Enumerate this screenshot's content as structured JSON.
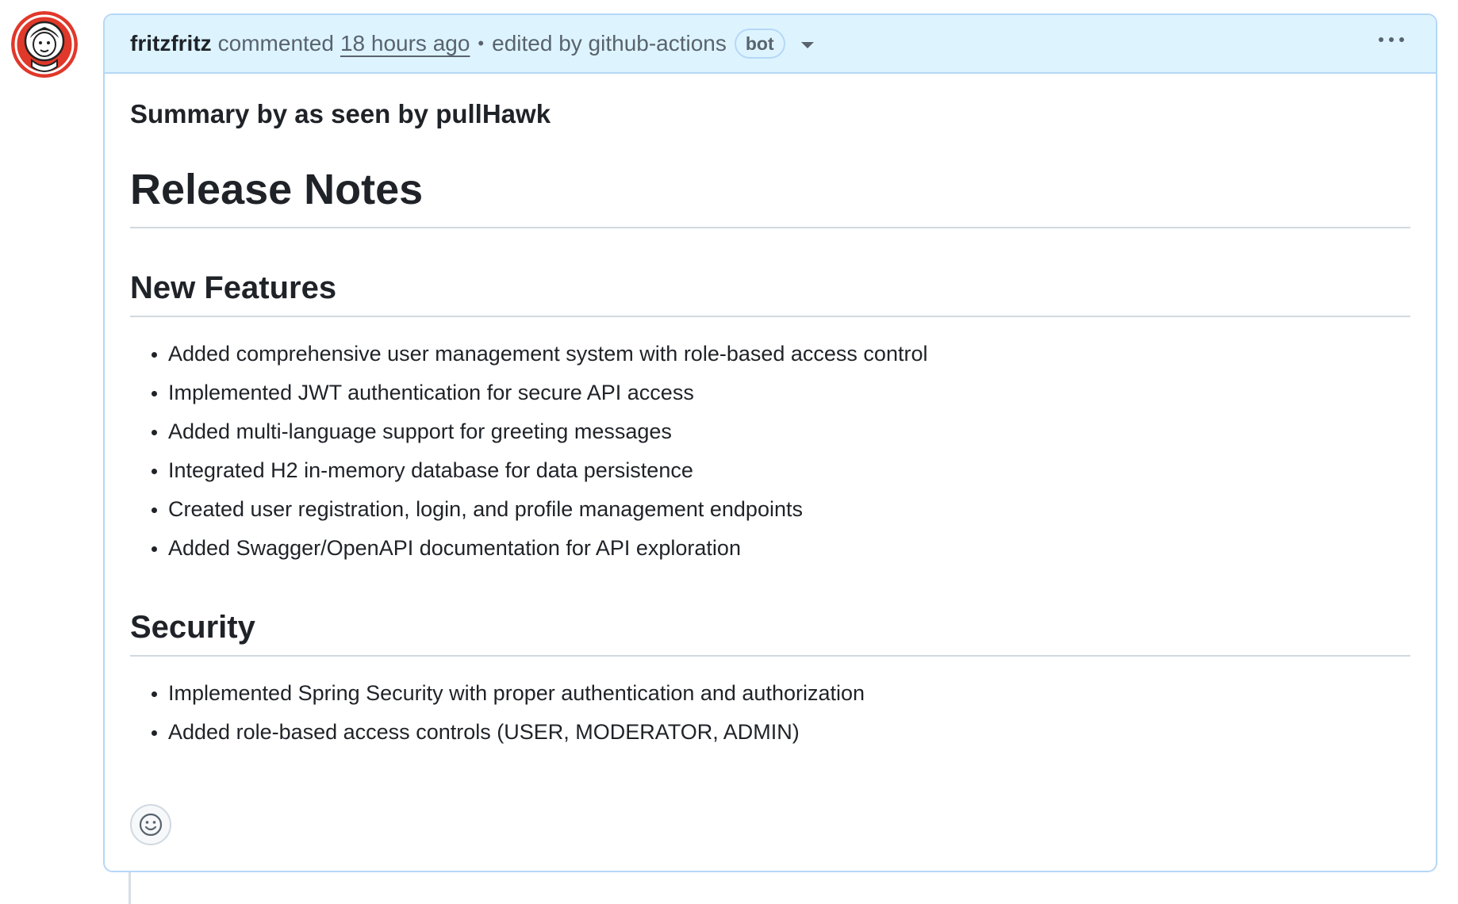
{
  "comment": {
    "author": "fritzfritz",
    "action": "commented",
    "timestamp": "18 hours ago",
    "separator": "•",
    "edited_by": "edited by github-actions",
    "badge": "bot"
  },
  "body": {
    "summary": "Summary by as seen by pullHawk",
    "title": "Release Notes",
    "sections": [
      {
        "heading": "New Features",
        "items": [
          "Added comprehensive user management system with role-based access control",
          "Implemented JWT authentication for secure API access",
          "Added multi-language support for greeting messages",
          "Integrated H2 in-memory database for data persistence",
          "Created user registration, login, and profile management endpoints",
          "Added Swagger/OpenAPI documentation for API exploration"
        ]
      },
      {
        "heading": "Security",
        "items": [
          "Implemented Spring Security with proper authentication and authorization",
          "Added role-based access controls (USER, MODERATOR, ADMIN)"
        ]
      }
    ]
  },
  "icons": {
    "avatar": "astronaut-avatar-icon",
    "kebab": "kebab-horizontal-icon",
    "caret": "triangle-down-icon",
    "reaction": "smiley-icon"
  },
  "colors": {
    "header_bg": "#ddf4ff",
    "header_border": "#b6d7f6",
    "avatar_red": "#e0382a"
  }
}
